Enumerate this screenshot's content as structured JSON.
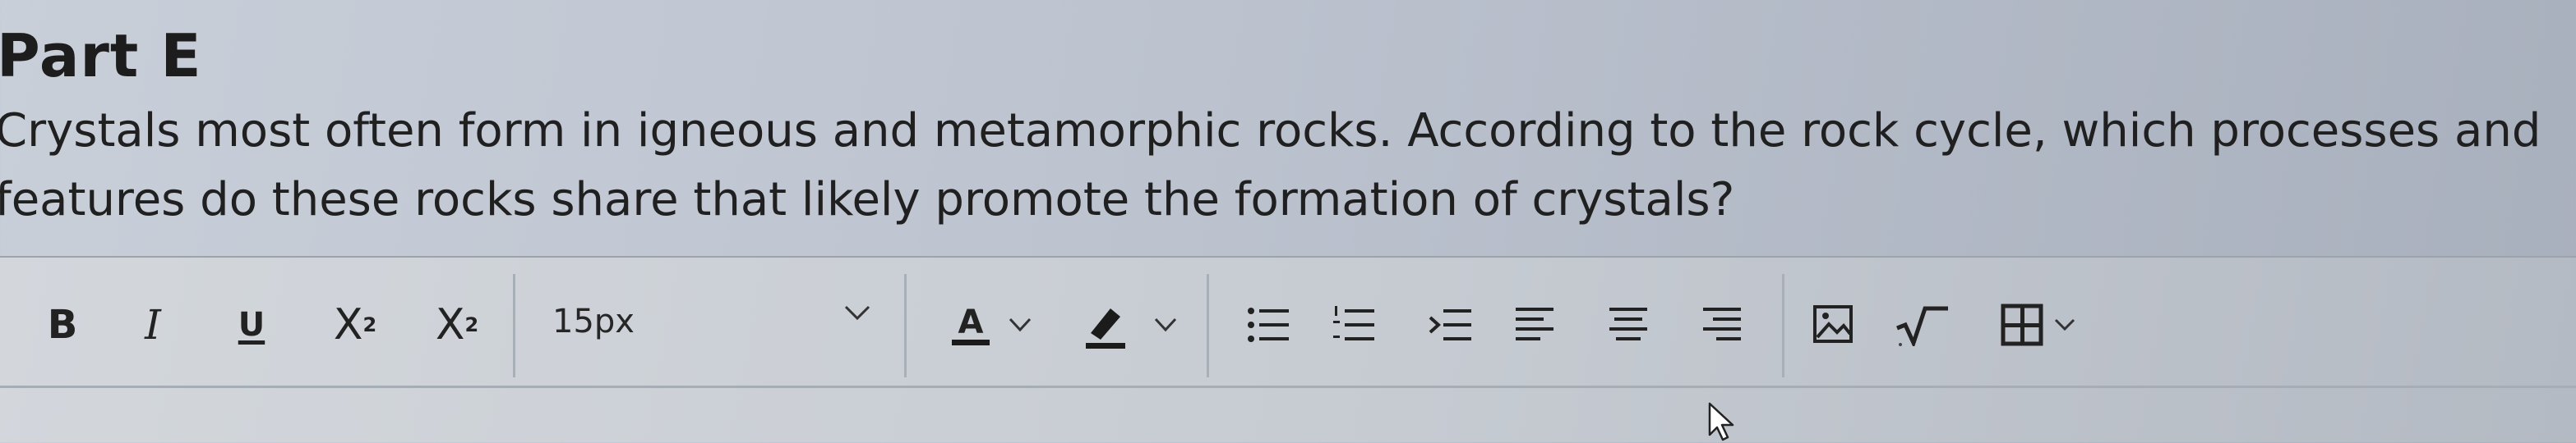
{
  "part": {
    "title": "Part E"
  },
  "question": {
    "line1": "Crystals most often form in igneous and metamorphic rocks. According to the rock cycle, which processes and",
    "line2": "features do these rocks share that likely promote the formation of crystals?"
  },
  "toolbar": {
    "bold_label": "B",
    "italic_label": "I",
    "underline_label": "U",
    "superscript_base": "X",
    "superscript_exp": "2",
    "subscript_base": "X",
    "subscript_sub": "2",
    "font_size": {
      "selected": "15px"
    },
    "text_color_label": "A",
    "icons": {
      "bullet_list": "bullet-list-icon",
      "numbered_list": "numbered-list-icon",
      "indent": "indent-icon",
      "align_left": "align-left-icon",
      "align_center": "align-center-icon",
      "align_right": "align-right-icon",
      "image": "insert-image-icon",
      "math": "square-root-icon",
      "table": "table-icon"
    }
  },
  "editor": {
    "content": ""
  }
}
